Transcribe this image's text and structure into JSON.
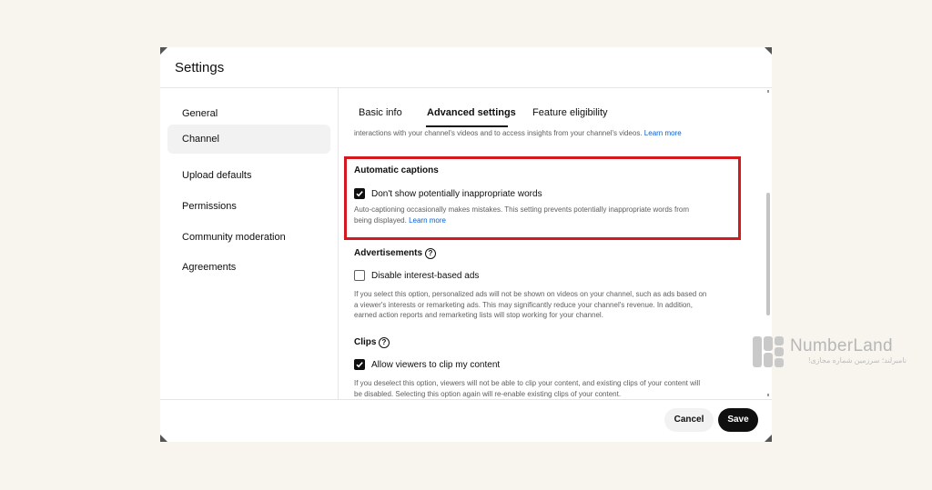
{
  "dialog": {
    "title": "Settings"
  },
  "sidebar": {
    "items": [
      {
        "label": "General",
        "active": false
      },
      {
        "label": "Channel",
        "active": true
      },
      {
        "label": "Upload defaults",
        "active": false
      },
      {
        "label": "Permissions",
        "active": false
      },
      {
        "label": "Community moderation",
        "active": false
      },
      {
        "label": "Agreements",
        "active": false
      }
    ]
  },
  "tabs": [
    {
      "label": "Basic info",
      "active": false
    },
    {
      "label": "Advanced settings",
      "active": true
    },
    {
      "label": "Feature eligibility",
      "active": false
    }
  ],
  "top_desc": {
    "text": "interactions with your channel's videos and to access insights from your channel's videos.",
    "link": "Learn more"
  },
  "captions": {
    "title": "Automatic captions",
    "option_label": "Don't show potentially inappropriate words",
    "checked": true,
    "desc_line1": "Auto-captioning occasionally makes mistakes. This setting prevents potentially inappropriate words from",
    "desc_line2": "being displayed.",
    "link": "Learn more"
  },
  "ads": {
    "title": "Advertisements",
    "help": "?",
    "option_label": "Disable interest-based ads",
    "checked": false,
    "desc_line1": "If you select this option, personalized ads will not be shown on videos on your channel, such as ads based on",
    "desc_line2": "a viewer's interests or remarketing ads. This may significantly reduce your channel's revenue. In addition,",
    "desc_line3": "earned action reports and remarketing lists will stop working for your channel."
  },
  "clips": {
    "title": "Clips",
    "help": "?",
    "option_label": "Allow viewers to clip my content",
    "checked": true,
    "desc_line1": "If you deselect this option, viewers will not be able to clip your content, and existing clips of your content will",
    "desc_line2": "be disabled. Selecting this option again will re-enable existing clips of your content."
  },
  "footer": {
    "cancel_label": "Cancel",
    "save_label": "Save"
  },
  "watermark": {
    "brand": "NumberLand",
    "tagline": "نامبرلند؛ سرزمین شماره مجازی!"
  },
  "colors": {
    "highlight": "#d3191f",
    "link": "#065fd4",
    "primary": "#0f0f0f",
    "background": "#f8f5ee"
  }
}
